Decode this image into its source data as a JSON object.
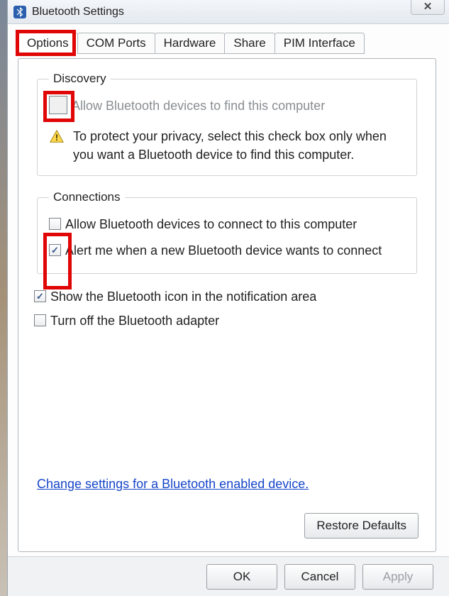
{
  "window": {
    "title": "Bluetooth Settings"
  },
  "tabs": [
    {
      "label": "Options",
      "active": true
    },
    {
      "label": "COM Ports",
      "active": false
    },
    {
      "label": "Hardware",
      "active": false
    },
    {
      "label": "Share",
      "active": false
    },
    {
      "label": "PIM Interface",
      "active": false
    }
  ],
  "discovery": {
    "legend": "Discovery",
    "allow_label": "Allow Bluetooth devices to find this computer",
    "allow_checked": false,
    "warning": "To protect your privacy, select this check box only when you want a Bluetooth device to find this computer."
  },
  "connections": {
    "legend": "Connections",
    "allow_label": "Allow Bluetooth devices to connect to this computer",
    "allow_checked": false,
    "alert_label": "Alert me when a new Bluetooth device wants to connect",
    "alert_checked": true
  },
  "misc": {
    "show_icon_label": "Show the Bluetooth icon in the notification area",
    "show_icon_checked": true,
    "turn_off_label": "Turn off the Bluetooth adapter",
    "turn_off_checked": false
  },
  "link": {
    "label": "Change settings for a Bluetooth enabled device."
  },
  "buttons": {
    "restore": "Restore Defaults",
    "ok": "OK",
    "cancel": "Cancel",
    "apply": "Apply"
  }
}
